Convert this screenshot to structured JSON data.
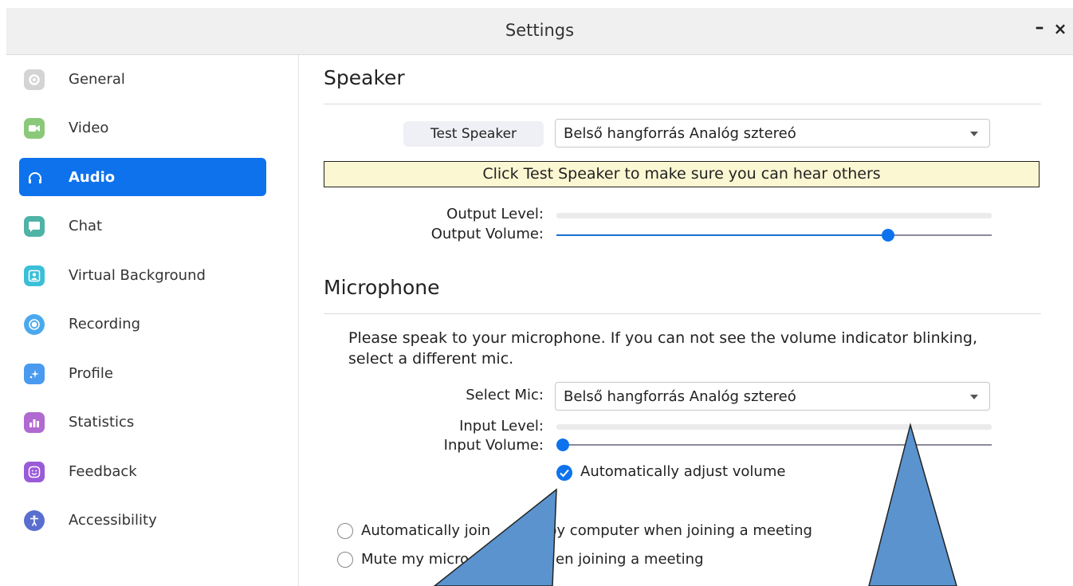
{
  "window": {
    "title": "Settings",
    "minimize_label": "–",
    "close_label": "×"
  },
  "sidebar": {
    "items": [
      {
        "label": "General",
        "icon": "gear-icon",
        "color": "#d4d4d4",
        "active": false
      },
      {
        "label": "Video",
        "icon": "video-camera-icon",
        "color": "#8bc97a",
        "active": false
      },
      {
        "label": "Audio",
        "icon": "headphones-icon",
        "color": "#0e72ed",
        "active": true
      },
      {
        "label": "Chat",
        "icon": "chat-bubble-icon",
        "color": "#4fb3a6",
        "active": false
      },
      {
        "label": "Virtual Background",
        "icon": "portrait-icon",
        "color": "#3bbfd8",
        "active": false
      },
      {
        "label": "Recording",
        "icon": "record-icon",
        "color": "#4aa9ee",
        "active": false
      },
      {
        "label": "Profile",
        "icon": "sparkle-icon",
        "color": "#4a9af0",
        "active": false
      },
      {
        "label": "Statistics",
        "icon": "bar-chart-icon",
        "color": "#b06ad0",
        "active": false
      },
      {
        "label": "Feedback",
        "icon": "smile-icon",
        "color": "#9a5bd8",
        "active": false
      },
      {
        "label": "Accessibility",
        "icon": "accessibility-icon",
        "color": "#5a6ed0",
        "active": false
      }
    ]
  },
  "speaker": {
    "title": "Speaker",
    "test_button": "Test Speaker",
    "device": "Belső hangforrás Analóg sztereó",
    "hint": "Click Test Speaker to make sure you can hear others",
    "output_level_label": "Output Level:",
    "output_volume_label": "Output Volume:",
    "output_level": 0,
    "output_volume": 0.77
  },
  "microphone": {
    "title": "Microphone",
    "description": "Please speak to your microphone. If you can not see the volume indicator blinking, select a different mic.",
    "select_label": "Select Mic:",
    "device": "Belső hangforrás Analóg sztereó",
    "input_level_label": "Input Level:",
    "input_volume_label": "Input Volume:",
    "input_level": 0,
    "input_volume": 0.0,
    "auto_adjust_label": "Automatically adjust volume",
    "auto_adjust_checked": true
  },
  "options": [
    {
      "label_before": "Automatically join",
      "label_after": "by computer when joining a meeting",
      "checked": false
    },
    {
      "label_before": "Mute my micro",
      "label_after": "en joining a meeting",
      "checked": false
    }
  ],
  "colors": {
    "accent": "#0e72ed",
    "hint_bg": "#fbf7d2",
    "annotation_arrow": "#5b93cf"
  }
}
